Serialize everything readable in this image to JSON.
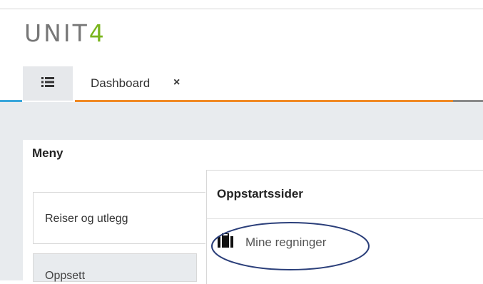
{
  "logo": {
    "main": "UNIT",
    "accent": "4"
  },
  "tabs": [
    {
      "icon": "list-icon",
      "active": true
    },
    {
      "label": "Dashboard",
      "close": "×"
    }
  ],
  "colors": {
    "blue": "#3aa7db",
    "orange": "#f08a24",
    "gray": "#8a8a8a",
    "logo_accent": "#7ab51d",
    "highlight_ring": "#2b3f7a"
  },
  "menu": {
    "title": "Meny",
    "items": [
      {
        "label": "Reiser og utlegg"
      },
      {
        "label": "Oppsett"
      }
    ]
  },
  "flyout": {
    "title": "Oppstartssider",
    "items": [
      {
        "label": "Mine regninger",
        "icon": "briefcase-icon"
      }
    ]
  }
}
